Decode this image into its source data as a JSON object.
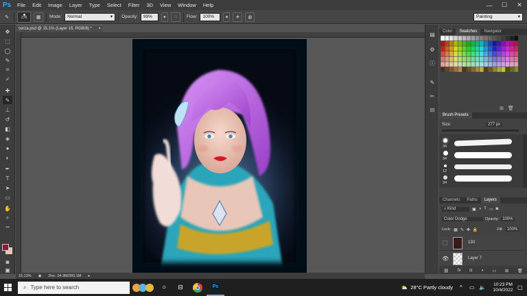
{
  "menubar": {
    "logo": "Ps",
    "items": [
      "File",
      "Edit",
      "Image",
      "Layer",
      "Type",
      "Select",
      "Filter",
      "3D",
      "View",
      "Window",
      "Help"
    ],
    "win_controls": [
      "—",
      "☐",
      "✕"
    ]
  },
  "options": {
    "brush_size": "278",
    "mode_label": "Mode:",
    "mode_value": "Normal",
    "opacity_label": "Opacity:",
    "opacity_value": "99%",
    "flow_label": "Flow:",
    "flow_value": "100%",
    "workspace": "Painting"
  },
  "document": {
    "tab_title": "cerza.psd @ 15.1% (Layer 16, RGB/8) *",
    "zoom": "15.13%",
    "doc_info": "Doc: 34.3M/393.1M"
  },
  "panels": {
    "color_tabs": [
      "Color",
      "Swatches",
      "Navigator"
    ],
    "brush_presets": {
      "title": "Brush Presets",
      "size_label": "Size:",
      "size_value": "277 px",
      "sizes": [
        "34",
        "34",
        "12",
        "34"
      ]
    },
    "layers": {
      "tabs": [
        "Channels",
        "Paths",
        "Layers"
      ],
      "kind_label": "Kind",
      "blend_mode": "Color Dodge",
      "opacity_label": "Opacity:",
      "opacity_value": "100%",
      "lock_label": "Lock:",
      "fill_label": "Fill:",
      "fill_value": "100%",
      "items": [
        "130",
        "Layer 7"
      ]
    }
  },
  "taskbar": {
    "search_placeholder": "Type here to search",
    "weather": "28°C  Partly cloudy",
    "time": "10:23 PM",
    "date": "10/4/2022"
  },
  "colors": {
    "foreground": "#a0103a",
    "background": "#f2c3b5",
    "hair": "#c06ae6",
    "cape": "#29a3b8",
    "ribbon": "#c8a52a"
  }
}
